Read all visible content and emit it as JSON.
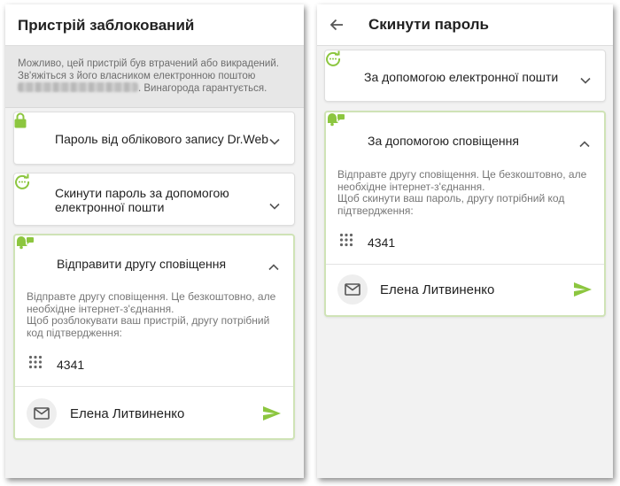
{
  "left_screen": {
    "title": "Пристрій заблокований",
    "warning_line1": "Можливо, цей пристрій був втрачений або викрадений.",
    "warning_line2": "Зв'яжіться з його власником електронною поштою",
    "warning_line3_suffix": ". Винагорода гарантується.",
    "cards": {
      "password": {
        "label": "Пароль від облікового запису Dr.Web"
      },
      "email": {
        "label_line1": "Скинути пароль за допомогою",
        "label_line2": "електронної пошти"
      },
      "notification": {
        "label": "Відправити другу сповіщення",
        "desc_line1": "Відправте другу сповіщення. Це безкоштовно, але",
        "desc_line2": "необхідне інтернет-з'єднання.",
        "desc_line3": "Щоб розблокувати ваш пристрій, другу потрібний",
        "desc_line4": "код підтвердження:",
        "code": "4341",
        "contact_name": "Елена Литвиненко"
      }
    }
  },
  "right_screen": {
    "title": "Скинути пароль",
    "cards": {
      "email": {
        "label": "За допомогою електронної пошти"
      },
      "notification": {
        "label": "За допомогою сповіщення",
        "desc_line1": "Відправте другу сповіщення. Це безкоштовно, але",
        "desc_line2": "необхідне інтернет-з'єднання.",
        "desc_line3": "Щоб скинути ваш пароль, другу потрібний код",
        "desc_line4": "підтвердження:",
        "code": "4341",
        "contact_name": "Елена Литвиненко"
      }
    }
  },
  "colors": {
    "accent_green": "#8cc63f",
    "card_border_active": "#cfe3b6",
    "warning_bg": "#e7e7e7"
  },
  "icons": [
    "lock-icon",
    "reset-refresh-icon",
    "notification-bell-icon",
    "chevron-down-icon",
    "chevron-up-icon",
    "dialpad-icon",
    "mail-icon",
    "send-icon",
    "back-arrow-icon"
  ]
}
